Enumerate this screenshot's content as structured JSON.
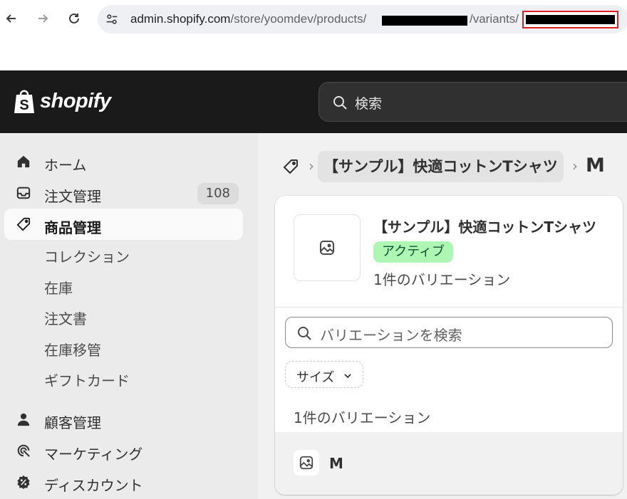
{
  "browser": {
    "url_host": "admin.shopify.com",
    "url_path": "/store/yoomdev/products/",
    "url_suffix": "/variants/"
  },
  "topbar": {
    "logo_text": "shopify",
    "search_placeholder": "検索"
  },
  "sidebar": {
    "items": [
      {
        "label": "ホーム",
        "icon": "home-icon"
      },
      {
        "label": "注文管理",
        "icon": "inbox-icon",
        "badge": "108"
      },
      {
        "label": "商品管理",
        "icon": "tag-icon",
        "active": true
      },
      {
        "label": "顧客管理",
        "icon": "person-icon"
      },
      {
        "label": "マーケティング",
        "icon": "target-icon"
      },
      {
        "label": "ディスカウント",
        "icon": "discount-icon"
      }
    ],
    "subitems": [
      "コレクション",
      "在庫",
      "注文書",
      "在庫移管",
      "ギフトカード"
    ]
  },
  "breadcrumb": {
    "product": "【サンプル】快適コットンTシャツ",
    "separator": "›",
    "current": "M"
  },
  "card": {
    "product_title": "【サンプル】快適コットンTシャツ",
    "status": "アクティブ",
    "variant_count": "1件のバリエーション",
    "search_placeholder": "バリエーションを検索",
    "filter_label": "サイズ",
    "list_header": "1件のバリエーション",
    "variants": [
      "M"
    ]
  },
  "colors": {
    "topbar_bg": "#1a1a1a",
    "sidebar_bg": "#ebebeb",
    "status_green_bg": "#aff5b4",
    "status_green_text": "#0c5132",
    "highlight_red": "#e02020"
  }
}
